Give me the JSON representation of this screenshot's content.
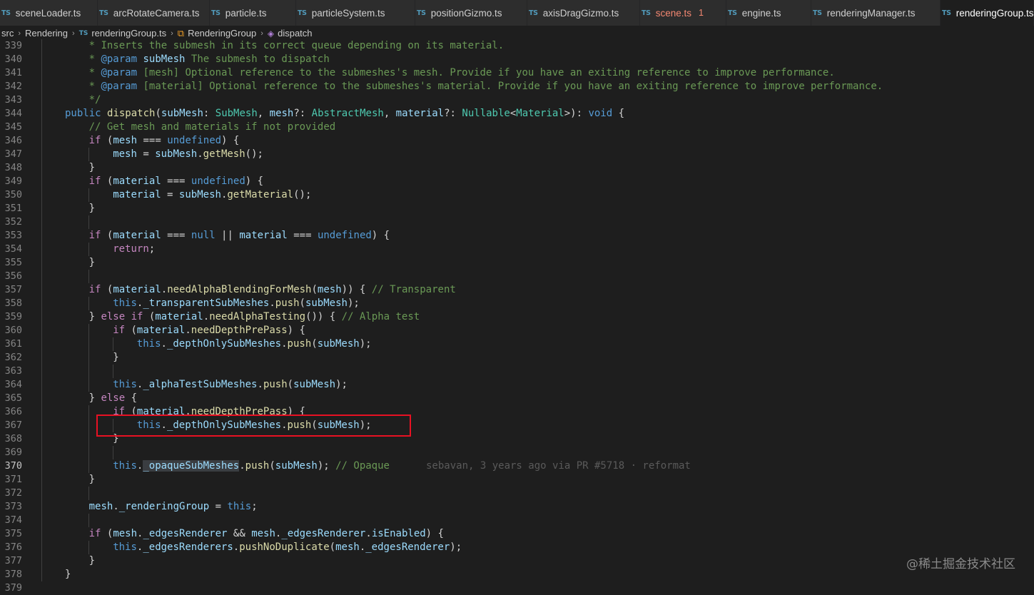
{
  "tabs": [
    {
      "label": "sceneLoader.ts",
      "badge": "",
      "icon": "ts-icon",
      "active": false,
      "modified": false
    },
    {
      "label": "arcRotateCamera.ts",
      "badge": "",
      "icon": "ts-icon",
      "active": false,
      "modified": false
    },
    {
      "label": "particle.ts",
      "badge": "",
      "icon": "ts-icon",
      "active": false,
      "modified": false
    },
    {
      "label": "particleSystem.ts",
      "badge": "",
      "icon": "ts-icon",
      "active": false,
      "modified": false
    },
    {
      "label": "positionGizmo.ts",
      "badge": "",
      "icon": "ts-icon",
      "active": false,
      "modified": false
    },
    {
      "label": "axisDragGizmo.ts",
      "badge": "",
      "icon": "ts-icon",
      "active": false,
      "modified": false
    },
    {
      "label": "scene.ts",
      "badge": "1",
      "icon": "ts-icon",
      "active": false,
      "modified": true
    },
    {
      "label": "engine.ts",
      "badge": "",
      "icon": "ts-icon",
      "active": false,
      "modified": false
    },
    {
      "label": "renderingManager.ts",
      "badge": "",
      "icon": "ts-icon",
      "active": false,
      "modified": false
    },
    {
      "label": "renderingGroup.ts",
      "badge": "",
      "icon": "ts-icon",
      "active": true,
      "modified": false
    }
  ],
  "ts_icon_text": "TS",
  "breadcrumb": {
    "items": [
      "src",
      "Rendering",
      "renderingGroup.ts",
      "RenderingGroup",
      "dispatch"
    ],
    "separator": "›"
  },
  "editor": {
    "current_line": 370,
    "lines": [
      {
        "n": 339,
        "indent": 1,
        "tokens": [
          [
            "c",
            "* Inserts the submesh in its correct queue depending on its material."
          ]
        ]
      },
      {
        "n": 340,
        "indent": 1,
        "tokens": [
          [
            "c",
            "* "
          ],
          [
            "k",
            "@param"
          ],
          [
            "p",
            " "
          ],
          [
            "v",
            "subMesh"
          ],
          [
            "c",
            " The submesh to dispatch"
          ]
        ]
      },
      {
        "n": 341,
        "indent": 1,
        "tokens": [
          [
            "c",
            "* "
          ],
          [
            "k",
            "@param"
          ],
          [
            "c",
            " [mesh] Optional reference to the submeshes's mesh. Provide if you have an exiting reference to improve performance."
          ]
        ]
      },
      {
        "n": 342,
        "indent": 1,
        "tokens": [
          [
            "c",
            "* "
          ],
          [
            "k",
            "@param"
          ],
          [
            "c",
            " [material] Optional reference to the submeshes's material. Provide if you have an exiting reference to improve performance."
          ]
        ]
      },
      {
        "n": 343,
        "indent": 1,
        "tokens": [
          [
            "c",
            "*/"
          ]
        ]
      },
      {
        "n": 344,
        "indent": 0,
        "tokens": [
          [
            "k",
            "public"
          ],
          [
            "p",
            " "
          ],
          [
            "fn",
            "dispatch"
          ],
          [
            "p",
            "("
          ],
          [
            "v",
            "subMesh"
          ],
          [
            "p",
            ": "
          ],
          [
            "t",
            "SubMesh"
          ],
          [
            "p",
            ", "
          ],
          [
            "v",
            "mesh"
          ],
          [
            "p",
            "?: "
          ],
          [
            "t",
            "AbstractMesh"
          ],
          [
            "p",
            ", "
          ],
          [
            "v",
            "material"
          ],
          [
            "p",
            "?: "
          ],
          [
            "t",
            "Nullable"
          ],
          [
            "p",
            "<"
          ],
          [
            "t",
            "Material"
          ],
          [
            "p",
            ">): "
          ],
          [
            "k",
            "void"
          ],
          [
            "p",
            " {"
          ]
        ]
      },
      {
        "n": 345,
        "indent": 1,
        "tokens": [
          [
            "c",
            "// Get mesh and materials if not provided"
          ]
        ]
      },
      {
        "n": 346,
        "indent": 1,
        "tokens": [
          [
            "ctl",
            "if"
          ],
          [
            "p",
            " ("
          ],
          [
            "v",
            "mesh"
          ],
          [
            "p",
            " === "
          ],
          [
            "k",
            "undefined"
          ],
          [
            "p",
            ") {"
          ]
        ]
      },
      {
        "n": 347,
        "indent": 2,
        "tokens": [
          [
            "v",
            "mesh"
          ],
          [
            "p",
            " = "
          ],
          [
            "v",
            "subMesh"
          ],
          [
            "p",
            "."
          ],
          [
            "fn",
            "getMesh"
          ],
          [
            "p",
            "();"
          ]
        ]
      },
      {
        "n": 348,
        "indent": 1,
        "tokens": [
          [
            "p",
            "}"
          ]
        ]
      },
      {
        "n": 349,
        "indent": 1,
        "tokens": [
          [
            "ctl",
            "if"
          ],
          [
            "p",
            " ("
          ],
          [
            "v",
            "material"
          ],
          [
            "p",
            " === "
          ],
          [
            "k",
            "undefined"
          ],
          [
            "p",
            ") {"
          ]
        ]
      },
      {
        "n": 350,
        "indent": 2,
        "tokens": [
          [
            "v",
            "material"
          ],
          [
            "p",
            " = "
          ],
          [
            "v",
            "subMesh"
          ],
          [
            "p",
            "."
          ],
          [
            "fn",
            "getMaterial"
          ],
          [
            "p",
            "();"
          ]
        ]
      },
      {
        "n": 351,
        "indent": 1,
        "tokens": [
          [
            "p",
            "}"
          ]
        ]
      },
      {
        "n": 352,
        "indent": 0,
        "tokens": []
      },
      {
        "n": 353,
        "indent": 1,
        "tokens": [
          [
            "ctl",
            "if"
          ],
          [
            "p",
            " ("
          ],
          [
            "v",
            "material"
          ],
          [
            "p",
            " === "
          ],
          [
            "k",
            "null"
          ],
          [
            "p",
            " || "
          ],
          [
            "v",
            "material"
          ],
          [
            "p",
            " === "
          ],
          [
            "k",
            "undefined"
          ],
          [
            "p",
            ") {"
          ]
        ]
      },
      {
        "n": 354,
        "indent": 2,
        "tokens": [
          [
            "ctl",
            "return"
          ],
          [
            "p",
            ";"
          ]
        ]
      },
      {
        "n": 355,
        "indent": 1,
        "tokens": [
          [
            "p",
            "}"
          ]
        ]
      },
      {
        "n": 356,
        "indent": 0,
        "tokens": []
      },
      {
        "n": 357,
        "indent": 1,
        "tokens": [
          [
            "ctl",
            "if"
          ],
          [
            "p",
            " ("
          ],
          [
            "v",
            "material"
          ],
          [
            "p",
            "."
          ],
          [
            "fn",
            "needAlphaBlendingForMesh"
          ],
          [
            "p",
            "("
          ],
          [
            "v",
            "mesh"
          ],
          [
            "p",
            ")) { "
          ],
          [
            "c",
            "// Transparent"
          ]
        ]
      },
      {
        "n": 358,
        "indent": 2,
        "tokens": [
          [
            "k",
            "this"
          ],
          [
            "p",
            "."
          ],
          [
            "v",
            "_transparentSubMeshes"
          ],
          [
            "p",
            "."
          ],
          [
            "fn",
            "push"
          ],
          [
            "p",
            "("
          ],
          [
            "v",
            "subMesh"
          ],
          [
            "p",
            ");"
          ]
        ]
      },
      {
        "n": 359,
        "indent": 1,
        "tokens": [
          [
            "p",
            "} "
          ],
          [
            "ctl",
            "else"
          ],
          [
            "p",
            " "
          ],
          [
            "ctl",
            "if"
          ],
          [
            "p",
            " ("
          ],
          [
            "v",
            "material"
          ],
          [
            "p",
            "."
          ],
          [
            "fn",
            "needAlphaTesting"
          ],
          [
            "p",
            "()) { "
          ],
          [
            "c",
            "// Alpha test"
          ]
        ]
      },
      {
        "n": 360,
        "indent": 2,
        "tokens": [
          [
            "ctl",
            "if"
          ],
          [
            "p",
            " ("
          ],
          [
            "v",
            "material"
          ],
          [
            "p",
            "."
          ],
          [
            "fn",
            "needDepthPrePass"
          ],
          [
            "p",
            ") {"
          ]
        ]
      },
      {
        "n": 361,
        "indent": 3,
        "tokens": [
          [
            "k",
            "this"
          ],
          [
            "p",
            "."
          ],
          [
            "v",
            "_depthOnlySubMeshes"
          ],
          [
            "p",
            "."
          ],
          [
            "fn",
            "push"
          ],
          [
            "p",
            "("
          ],
          [
            "v",
            "subMesh"
          ],
          [
            "p",
            ");"
          ]
        ]
      },
      {
        "n": 362,
        "indent": 2,
        "tokens": [
          [
            "p",
            "}"
          ]
        ]
      },
      {
        "n": 363,
        "indent": 0,
        "tokens": []
      },
      {
        "n": 364,
        "indent": 2,
        "tokens": [
          [
            "k",
            "this"
          ],
          [
            "p",
            "."
          ],
          [
            "v",
            "_alphaTestSubMeshes"
          ],
          [
            "p",
            "."
          ],
          [
            "fn",
            "push"
          ],
          [
            "p",
            "("
          ],
          [
            "v",
            "subMesh"
          ],
          [
            "p",
            ");"
          ]
        ]
      },
      {
        "n": 365,
        "indent": 1,
        "tokens": [
          [
            "p",
            "} "
          ],
          [
            "ctl",
            "else"
          ],
          [
            "p",
            " {"
          ]
        ]
      },
      {
        "n": 366,
        "indent": 2,
        "tokens": [
          [
            "ctl",
            "if"
          ],
          [
            "p",
            " ("
          ],
          [
            "v",
            "material"
          ],
          [
            "p",
            "."
          ],
          [
            "fn",
            "needDepthPrePass"
          ],
          [
            "p",
            ") {"
          ]
        ]
      },
      {
        "n": 367,
        "indent": 3,
        "tokens": [
          [
            "k",
            "this"
          ],
          [
            "p",
            "."
          ],
          [
            "v",
            "_depthOnlySubMeshes"
          ],
          [
            "p",
            "."
          ],
          [
            "fn",
            "push"
          ],
          [
            "p",
            "("
          ],
          [
            "v",
            "subMesh"
          ],
          [
            "p",
            ");"
          ]
        ]
      },
      {
        "n": 368,
        "indent": 2,
        "tokens": [
          [
            "p",
            "}"
          ]
        ]
      },
      {
        "n": 369,
        "indent": 0,
        "tokens": []
      },
      {
        "n": 370,
        "indent": 2,
        "tokens": [
          [
            "k",
            "this"
          ],
          [
            "p",
            "."
          ],
          [
            "v hl",
            "_opaqueSubMeshes"
          ],
          [
            "p",
            "."
          ],
          [
            "fn",
            "push"
          ],
          [
            "p",
            "("
          ],
          [
            "v",
            "subMesh"
          ],
          [
            "p",
            "); "
          ],
          [
            "c",
            "// Opaque"
          ]
        ],
        "blame": "sebavan, 3 years ago via PR #5718 · reformat"
      },
      {
        "n": 371,
        "indent": 1,
        "tokens": [
          [
            "p",
            "}"
          ]
        ]
      },
      {
        "n": 372,
        "indent": 0,
        "tokens": []
      },
      {
        "n": 373,
        "indent": 1,
        "tokens": [
          [
            "v",
            "mesh"
          ],
          [
            "p",
            "."
          ],
          [
            "v",
            "_renderingGroup"
          ],
          [
            "p",
            " = "
          ],
          [
            "k",
            "this"
          ],
          [
            "p",
            ";"
          ]
        ]
      },
      {
        "n": 374,
        "indent": 0,
        "tokens": []
      },
      {
        "n": 375,
        "indent": 1,
        "tokens": [
          [
            "ctl",
            "if"
          ],
          [
            "p",
            " ("
          ],
          [
            "v",
            "mesh"
          ],
          [
            "p",
            "."
          ],
          [
            "v",
            "_edgesRenderer"
          ],
          [
            "p",
            " && "
          ],
          [
            "v",
            "mesh"
          ],
          [
            "p",
            "."
          ],
          [
            "v",
            "_edgesRenderer"
          ],
          [
            "p",
            "."
          ],
          [
            "v",
            "isEnabled"
          ],
          [
            "p",
            ") {"
          ]
        ]
      },
      {
        "n": 376,
        "indent": 2,
        "tokens": [
          [
            "k",
            "this"
          ],
          [
            "p",
            "."
          ],
          [
            "v",
            "_edgesRenderers"
          ],
          [
            "p",
            "."
          ],
          [
            "fn",
            "pushNoDuplicate"
          ],
          [
            "p",
            "("
          ],
          [
            "v",
            "mesh"
          ],
          [
            "p",
            "."
          ],
          [
            "v",
            "_edgesRenderer"
          ],
          [
            "p",
            ");"
          ]
        ]
      },
      {
        "n": 377,
        "indent": 1,
        "tokens": [
          [
            "p",
            "}"
          ]
        ]
      },
      {
        "n": 378,
        "indent": 0,
        "tokens": [
          [
            "p",
            "}"
          ]
        ]
      },
      {
        "n": 379,
        "indent": 0,
        "tokens": []
      }
    ]
  },
  "watermark": "@稀土掘金技术社区",
  "colors": {
    "editor_bg": "#1e1e1e",
    "tab_inactive_bg": "#2d2d2d",
    "annotation_box": "#e81123",
    "ts_icon": "#519aba"
  }
}
